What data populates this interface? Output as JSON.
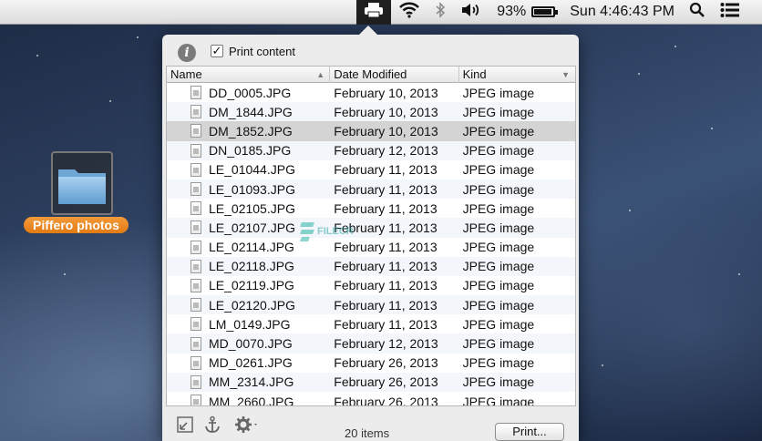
{
  "menubar": {
    "battery_percent": "93%",
    "battery_level": 0.93,
    "clock": "Sun 4:46:43 PM",
    "icons": [
      "printer-icon",
      "wifi-icon",
      "bluetooth-icon",
      "volume-icon",
      "battery-icon",
      "spotlight-search-icon",
      "notification-center-icon"
    ]
  },
  "desktop": {
    "folder_label": "Piffero photos"
  },
  "popover": {
    "print_content_label": "Print content",
    "print_content_checked": true,
    "columns": {
      "name": "Name",
      "date": "Date Modified",
      "kind": "Kind"
    },
    "files": [
      {
        "name": "DD_0005.JPG",
        "date": "February 10, 2013",
        "kind": "JPEG image"
      },
      {
        "name": "DM_1844.JPG",
        "date": "February 10, 2013",
        "kind": "JPEG image"
      },
      {
        "name": "DM_1852.JPG",
        "date": "February 10, 2013",
        "kind": "JPEG image",
        "selected": true
      },
      {
        "name": "DN_0185.JPG",
        "date": "February 12, 2013",
        "kind": "JPEG image"
      },
      {
        "name": "LE_01044.JPG",
        "date": "February 11, 2013",
        "kind": "JPEG image"
      },
      {
        "name": "LE_01093.JPG",
        "date": "February 11, 2013",
        "kind": "JPEG image"
      },
      {
        "name": "LE_02105.JPG",
        "date": "February 11, 2013",
        "kind": "JPEG image"
      },
      {
        "name": "LE_02107.JPG",
        "date": "February 11, 2013",
        "kind": "JPEG image"
      },
      {
        "name": "LE_02114.JPG",
        "date": "February 11, 2013",
        "kind": "JPEG image"
      },
      {
        "name": "LE_02118.JPG",
        "date": "February 11, 2013",
        "kind": "JPEG image"
      },
      {
        "name": "LE_02119.JPG",
        "date": "February 11, 2013",
        "kind": "JPEG image"
      },
      {
        "name": "LE_02120.JPG",
        "date": "February 11, 2013",
        "kind": "JPEG image"
      },
      {
        "name": "LM_0149.JPG",
        "date": "February 11, 2013",
        "kind": "JPEG image"
      },
      {
        "name": "MD_0070.JPG",
        "date": "February 12, 2013",
        "kind": "JPEG image"
      },
      {
        "name": "MD_0261.JPG",
        "date": "February 26, 2013",
        "kind": "JPEG image"
      },
      {
        "name": "MM_2314.JPG",
        "date": "February 26, 2013",
        "kind": "JPEG image"
      },
      {
        "name": "MM_2660.JPG",
        "date": "February 26, 2013",
        "kind": "JPEG image"
      }
    ],
    "items_count": "20 items",
    "print_button": "Print..."
  },
  "watermark": {
    "text": "FILECR"
  }
}
